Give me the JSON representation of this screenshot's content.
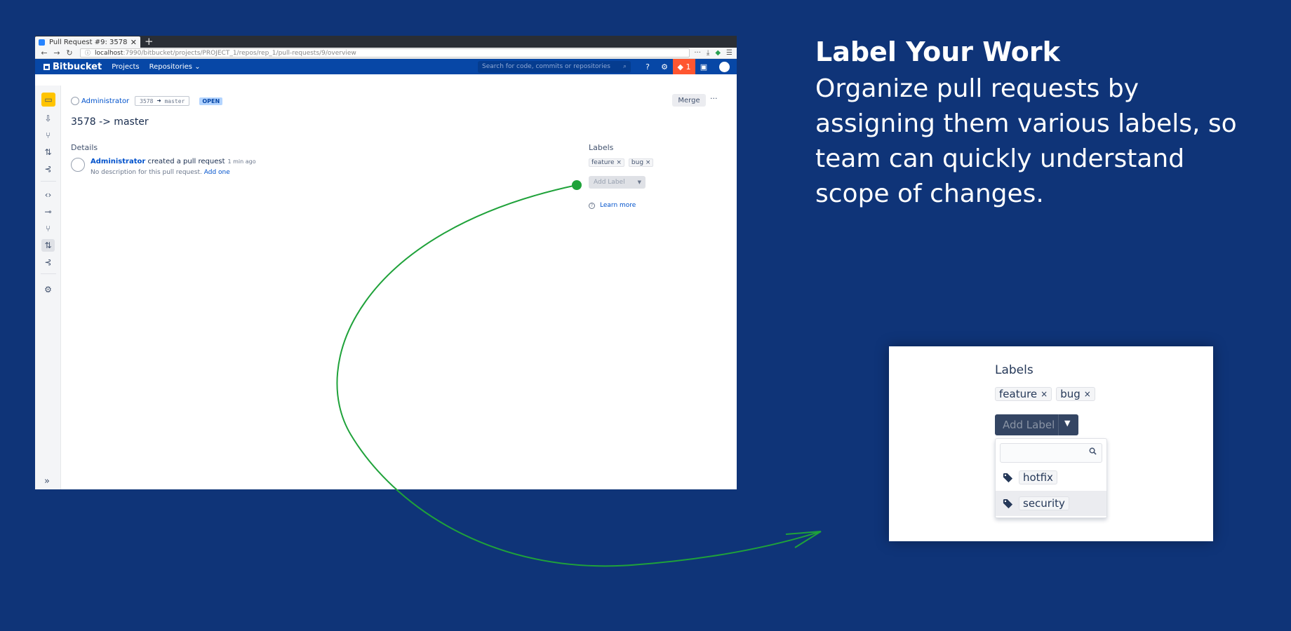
{
  "browser": {
    "tab_title": "Pull Request #9: 3578 ->",
    "tab_close": "✕",
    "new_tab": "+",
    "url_host": "localhost",
    "url_path": ":7990/bitbucket/projects/PROJECT_1/repos/rep_1/pull-requests/9/overview",
    "menu_dots": "···"
  },
  "header": {
    "logo": "Bitbucket",
    "nav_projects": "Projects",
    "nav_repositories": "Repositories ⌄",
    "search_placeholder": "Search for code, commits or repositories",
    "notification_count": "1"
  },
  "pr": {
    "author": "Administrator",
    "source_branch": "3578",
    "target_branch": "master",
    "status": "OPEN",
    "merge_label": "Merge",
    "more_label": "···",
    "title": "3578 -> master",
    "details_heading": "Details",
    "activity_user": "Administrator",
    "activity_action": " created a pull request",
    "activity_time": "1 min ago",
    "activity_desc": "No description for this pull request. ",
    "activity_add": "Add one",
    "expand": "»"
  },
  "labels": {
    "heading": "Labels",
    "items": [
      "feature ×",
      "bug ×"
    ],
    "add_label": "Add Label",
    "learn_more": "Learn more"
  },
  "promo": {
    "headline": "Label Your Work",
    "description": "Organize pull requests by assigning them various labels, so team can quickly understand scope of changes."
  },
  "zoom": {
    "heading": "Labels",
    "chips": [
      "feature",
      "bug"
    ],
    "chip_remove": "×",
    "add_label": "Add Label",
    "options": [
      "hotfix",
      "security"
    ]
  },
  "colors": {
    "background": "#0f3478",
    "bitbucket_blue": "#0747a6",
    "arrow_green": "#1fa23a",
    "notification": "#ff5630"
  }
}
